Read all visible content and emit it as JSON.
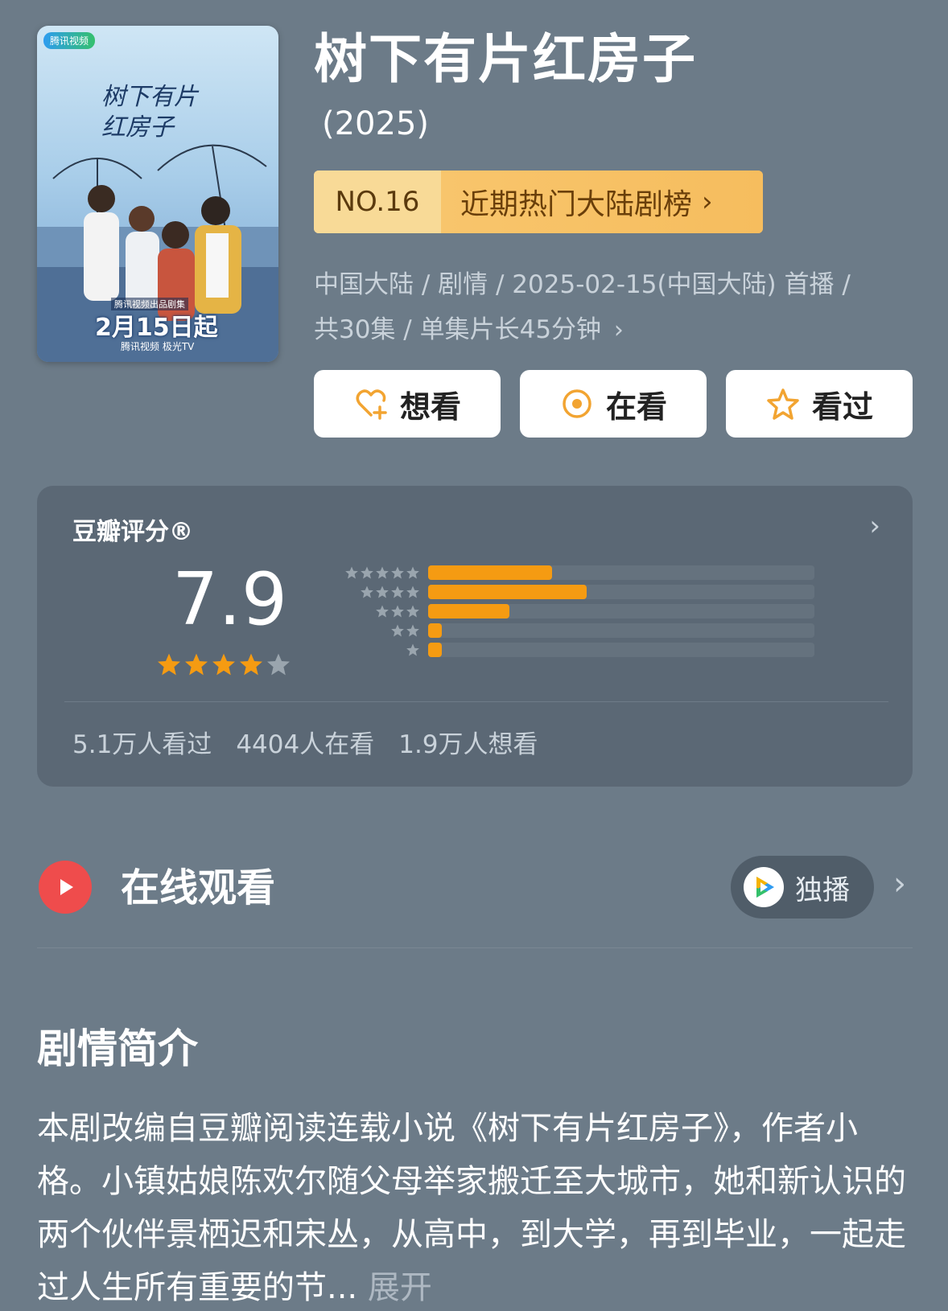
{
  "poster": {
    "logo_text": "腾讯视频",
    "title_text": "树下有片红房子",
    "subtitle": "腾讯视频出品剧集",
    "date_text": "2月15日起",
    "brand_text": "腾讯视频 极光TV"
  },
  "header": {
    "title": "树下有片红房子",
    "year": "(2025)"
  },
  "rank": {
    "number": "NO.16",
    "label": "近期热门大陆剧榜"
  },
  "meta": {
    "line1": "中国大陆 / 剧情 / 2025-02-15(中国大陆) 首播 /",
    "line2": "共30集 / 单集片长45分钟"
  },
  "actions": {
    "want": "想看",
    "watching": "在看",
    "watched": "看过"
  },
  "rating": {
    "label": "豆瓣评分®",
    "score": "7.9",
    "score_stars_filled": 4,
    "distribution": [
      {
        "stars": 5,
        "fraction": 0.32
      },
      {
        "stars": 4,
        "fraction": 0.41
      },
      {
        "stars": 3,
        "fraction": 0.21
      },
      {
        "stars": 2,
        "fraction": 0.035
      },
      {
        "stars": 1,
        "fraction": 0.035
      }
    ],
    "stats": {
      "watched": "5.1万人看过",
      "watching": "4404人在看",
      "want": "1.9万人想看"
    }
  },
  "watch_online": {
    "title": "在线观看",
    "exclusive_label": "独播"
  },
  "synopsis": {
    "title": "剧情简介",
    "text": "本剧改编自豆瓣阅读连载小说《树下有片红房子》，作者小格。小镇姑娘陈欢尔随父母举家搬迁至大城市，她和新认识的两个伙伴景栖迟和宋丛，从高中，到大学，再到毕业，一起走过人生所有重要的节...",
    "expand_label": "展开"
  },
  "colors": {
    "background": "#6c7b88",
    "rank_gold": "#f6c36a",
    "star_orange": "#f59b12",
    "star_gray": "#9aa5ae",
    "watch_red": "#ef4c4c"
  }
}
